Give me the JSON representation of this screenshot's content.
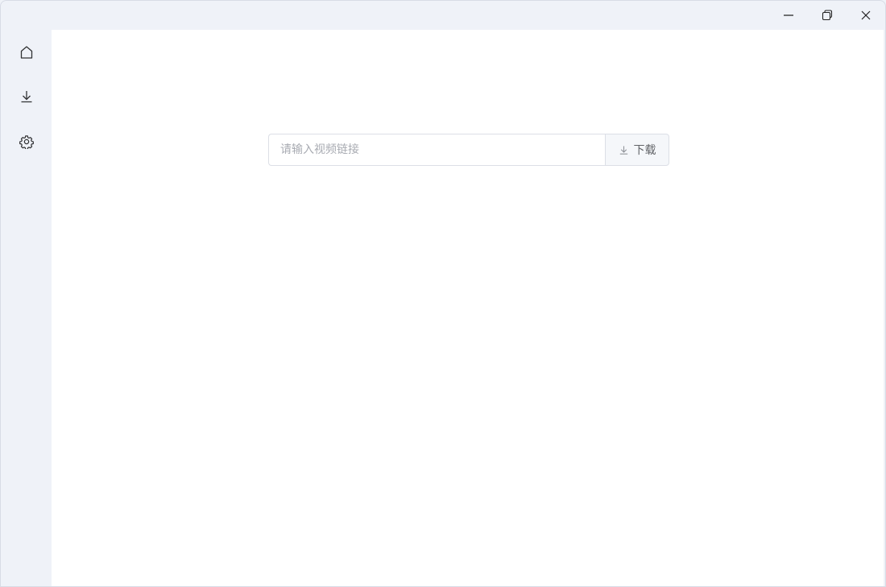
{
  "window_controls": {
    "minimize": "minimize-icon",
    "maximize": "restore-icon",
    "close": "close-icon"
  },
  "sidebar": {
    "items": [
      {
        "id": "home",
        "icon": "home-icon"
      },
      {
        "id": "downloads",
        "icon": "download-icon"
      },
      {
        "id": "settings",
        "icon": "gear-icon"
      }
    ]
  },
  "main": {
    "url_input": {
      "value": "",
      "placeholder": "请输入视频链接"
    },
    "download_button": {
      "icon": "download-icon",
      "label": "下载"
    }
  },
  "colors": {
    "background": "#eff2f8",
    "content": "#ffffff",
    "border": "#dcdfe6",
    "button_bg": "#f5f7fa",
    "icon": "#303133"
  }
}
